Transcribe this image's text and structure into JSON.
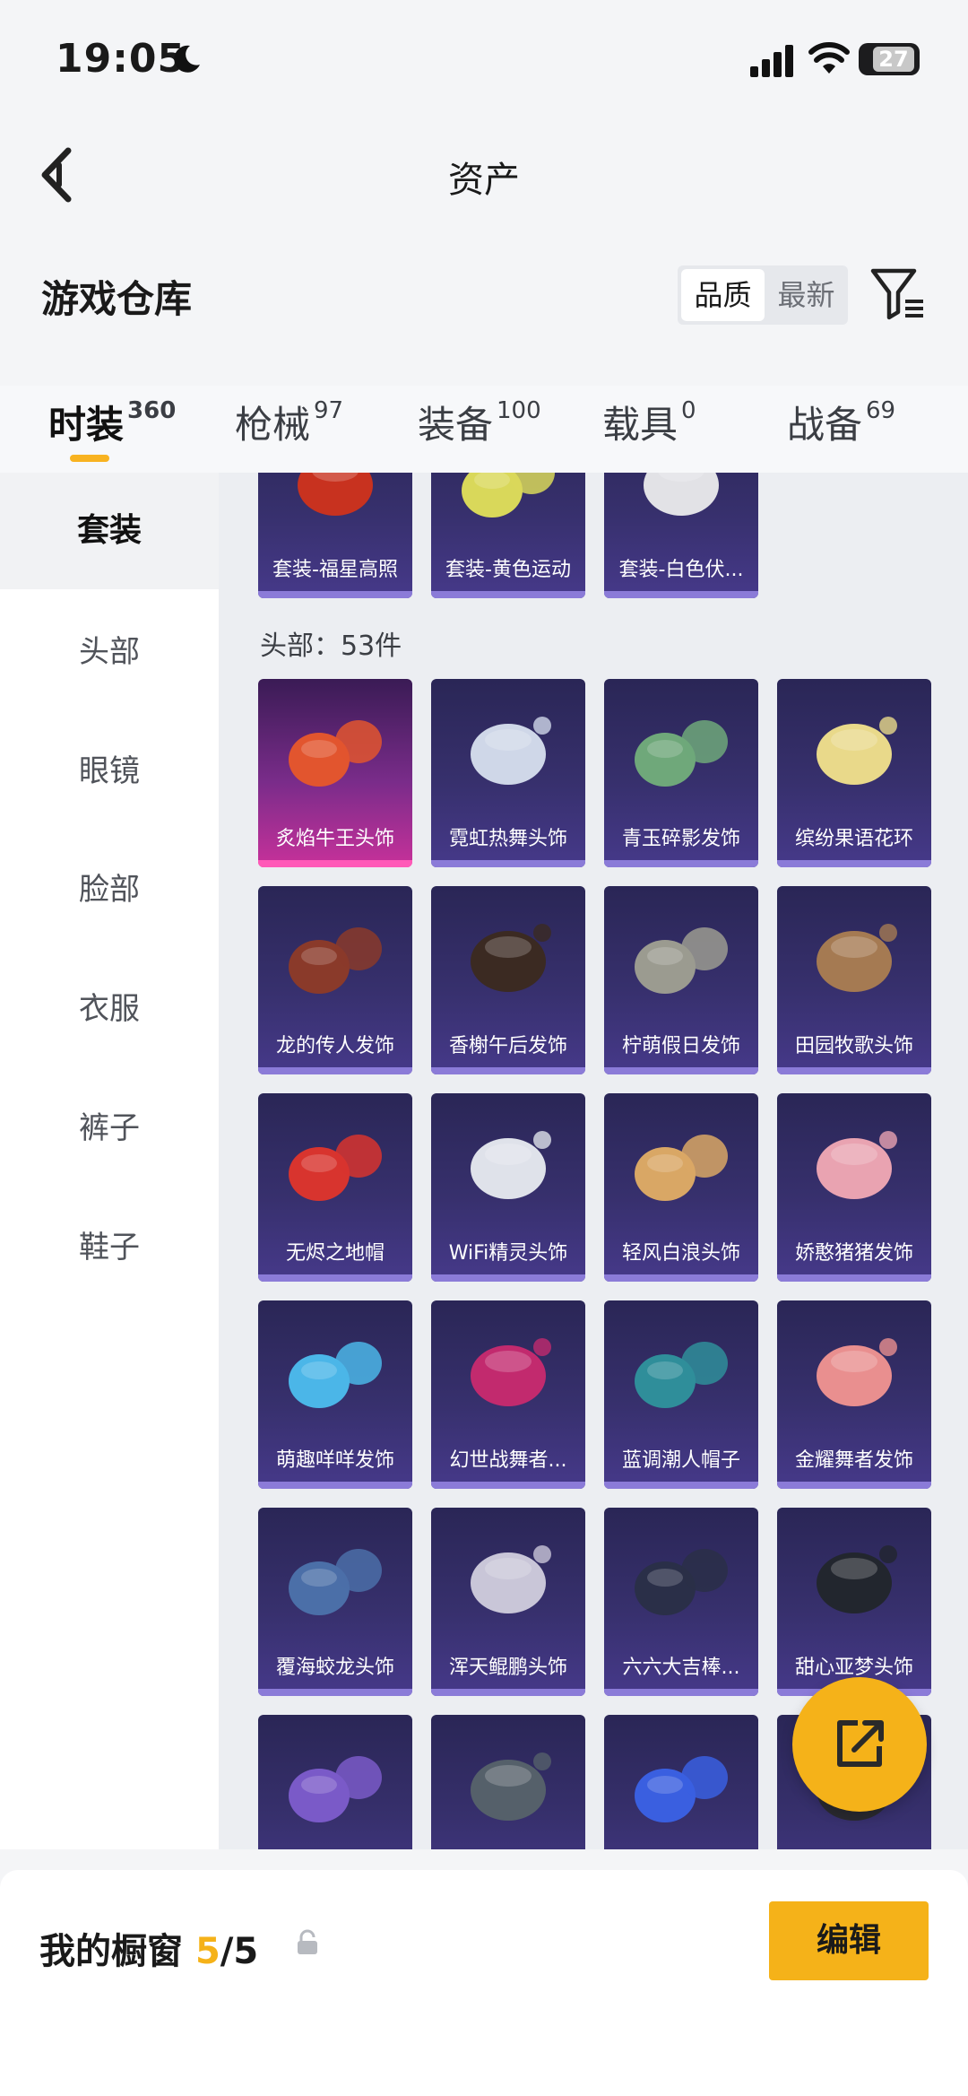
{
  "status": {
    "time": "19:05",
    "battery": "27"
  },
  "nav": {
    "title": "资产"
  },
  "warehouse": {
    "title": "游戏仓库",
    "sort": [
      "品质",
      "最新"
    ]
  },
  "tabs": [
    {
      "label": "时装",
      "count": "360"
    },
    {
      "label": "枪械",
      "count": "97"
    },
    {
      "label": "装备",
      "count": "100"
    },
    {
      "label": "载具",
      "count": "0"
    },
    {
      "label": "战备",
      "count": "69"
    }
  ],
  "sidebar": [
    "套装",
    "头部",
    "眼镜",
    "脸部",
    "衣服",
    "裤子",
    "鞋子"
  ],
  "suits": [
    "套装-福星高照",
    "套装-黄色运动",
    "套装-白色伏..."
  ],
  "head_section": {
    "title": "头部：53件"
  },
  "head_items": [
    "炙焰牛王头饰",
    "霓虹热舞头饰",
    "青玉碎影发饰",
    "缤纷果语花环",
    "龙的传人发饰",
    "香榭午后发饰",
    "柠萌假日发饰",
    "田园牧歌头饰",
    "无烬之地帽",
    "WiFi精灵头饰",
    "轻风白浪头饰",
    "娇憨猪猪发饰",
    "萌趣咩咩发饰",
    "幻世战舞者...",
    "蓝调潮人帽子",
    "金耀舞者发饰",
    "覆海蛟龙头饰",
    "浑天鲲鹏头饰",
    "六六大吉棒...",
    "甜心亚梦头饰",
    "",
    "",
    "",
    ""
  ],
  "item_colors": [
    "#e2552e",
    "#cfd7e8",
    "#6fa87a",
    "#e9d98a",
    "#8a3a2a",
    "#3b2a22",
    "#9b9b90",
    "#a57a52",
    "#d8342e",
    "#dfe2ea",
    "#d9a765",
    "#e9a3b1",
    "#4bb6e8",
    "#c22a6e",
    "#2f8e9a",
    "#e98f8f",
    "#4b6fa8",
    "#c9c6d8",
    "#2a2f48",
    "#22262e",
    "#7a5ac8",
    "#55606a",
    "#3a5fe0",
    "#2a2a30"
  ],
  "showcase": {
    "label": "我的橱窗",
    "used": "5",
    "total": "/5"
  },
  "edit_label": "编辑"
}
